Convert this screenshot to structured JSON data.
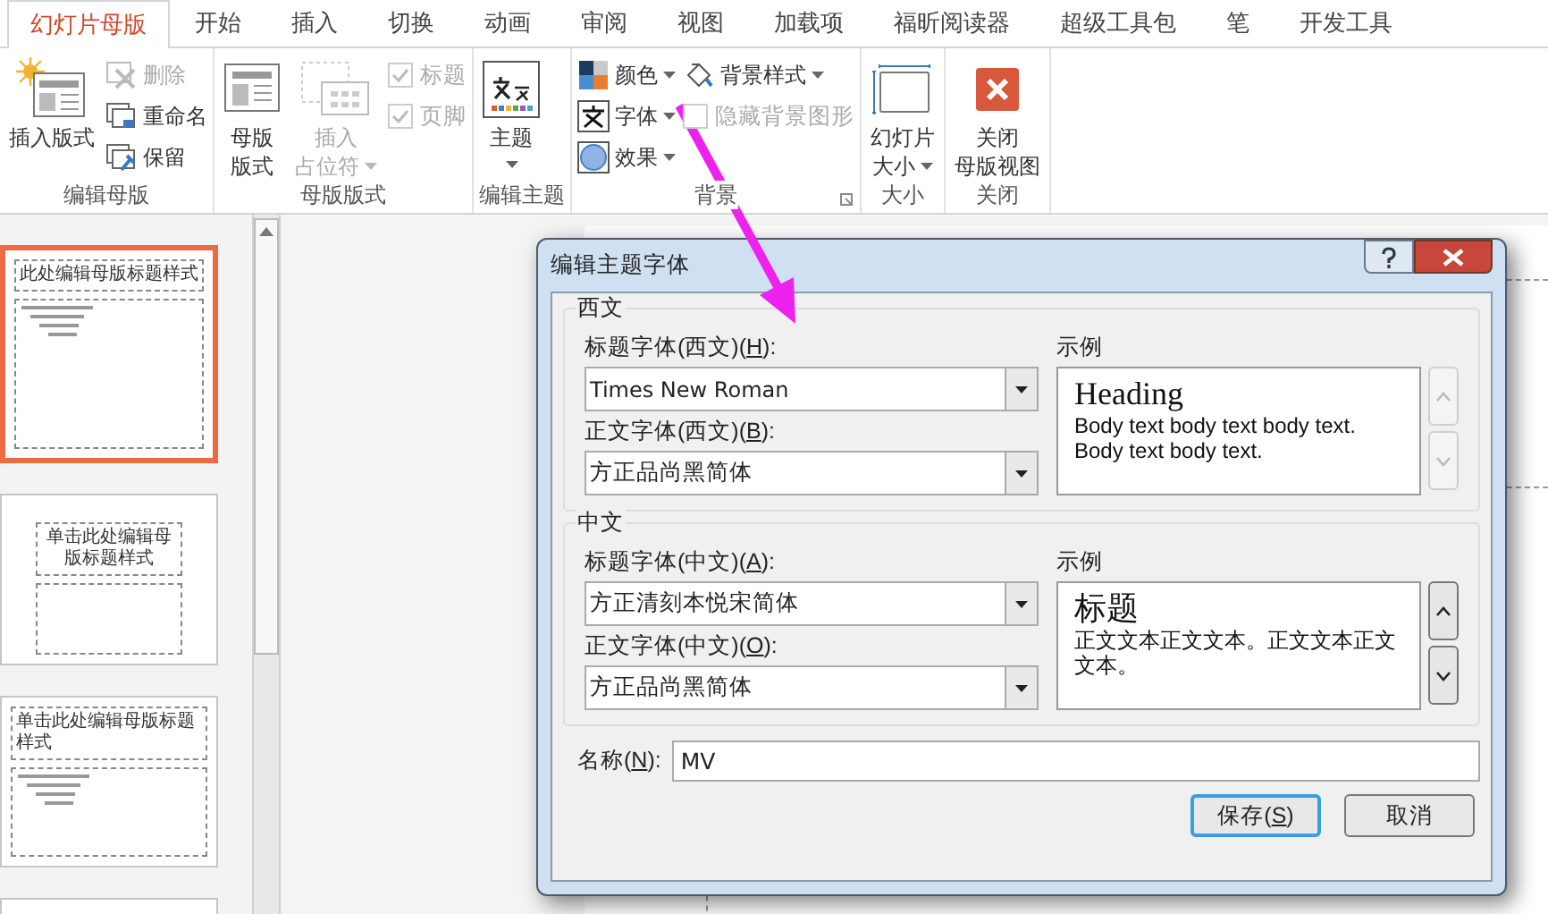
{
  "tabs": [
    {
      "label": "幻灯片母版",
      "selected": true
    },
    {
      "label": "开始",
      "selected": false
    },
    {
      "label": "插入",
      "selected": false
    },
    {
      "label": "切换",
      "selected": false
    },
    {
      "label": "动画",
      "selected": false
    },
    {
      "label": "审阅",
      "selected": false
    },
    {
      "label": "视图",
      "selected": false
    },
    {
      "label": "加载项",
      "selected": false
    },
    {
      "label": "福昕阅读器",
      "selected": false
    },
    {
      "label": "超级工具包",
      "selected": false
    },
    {
      "label": "笔",
      "selected": false
    },
    {
      "label": "开发工具",
      "selected": false
    }
  ],
  "ribbon_groups": [
    {
      "label": "编辑母版",
      "items": [
        {
          "kind": "large",
          "lines": [
            "插入版式"
          ],
          "disabled": false,
          "dropdown": false
        },
        {
          "kind": "column",
          "items": [
            {
              "kind": "small",
              "label": "删除",
              "disabled": true,
              "dropdown": false
            },
            {
              "kind": "small",
              "label": "重命名",
              "disabled": false,
              "dropdown": false
            },
            {
              "kind": "small",
              "label": "保留",
              "disabled": false,
              "dropdown": false
            }
          ]
        }
      ]
    },
    {
      "label": "母版版式",
      "items": [
        {
          "kind": "large",
          "lines": [
            "母版",
            "版式"
          ],
          "disabled": false,
          "dropdown": false
        },
        {
          "kind": "large",
          "lines": [
            "插入",
            "占位符"
          ],
          "disabled": true,
          "dropdown": true
        },
        {
          "kind": "column",
          "items": [
            {
              "kind": "checkbox",
              "label": "标题",
              "checked": true,
              "disabled": true
            },
            {
              "kind": "checkbox",
              "label": "页脚",
              "checked": true,
              "disabled": true
            }
          ]
        }
      ]
    },
    {
      "label": "编辑主题",
      "items": [
        {
          "kind": "large",
          "lines": [
            "主题"
          ],
          "disabled": false,
          "dropdown": true
        }
      ]
    },
    {
      "label": "背景",
      "launcher": true,
      "items": [
        {
          "kind": "column",
          "items": [
            {
              "kind": "small",
              "label": "颜色",
              "disabled": false,
              "dropdown": true
            },
            {
              "kind": "small",
              "label": "字体",
              "disabled": false,
              "dropdown": true
            },
            {
              "kind": "small",
              "label": "效果",
              "disabled": false,
              "dropdown": true
            }
          ]
        },
        {
          "kind": "column",
          "items": [
            {
              "kind": "small",
              "label": "背景样式",
              "disabled": false,
              "dropdown": true
            },
            {
              "kind": "checkbox",
              "label": "隐藏背景图形",
              "checked": false,
              "disabled": true
            }
          ]
        }
      ]
    },
    {
      "label": "大小",
      "items": [
        {
          "kind": "large",
          "lines": [
            "幻灯片",
            "大小"
          ],
          "disabled": false,
          "dropdown": true
        }
      ]
    },
    {
      "label": "关闭",
      "items": [
        {
          "kind": "large",
          "lines": [
            "关闭",
            "母版视图"
          ],
          "disabled": false,
          "dropdown": false
        }
      ]
    }
  ],
  "thumbnails": [
    {
      "title": "此处编辑母版标题样式",
      "kind": "master",
      "selected": true
    },
    {
      "title": "单击此处编辑母版标题样式",
      "kind": "title",
      "selected": false
    },
    {
      "title": "单击此处编辑母版标题样式",
      "kind": "content",
      "selected": false
    },
    {
      "kind": "blank",
      "selected": false
    }
  ],
  "dialog": {
    "title": "编辑主题字体",
    "sections": [
      {
        "heading": "西文",
        "fields": [
          {
            "label": "标题字体(西文)(H):",
            "value": "Times New Roman"
          },
          {
            "label": "正文字体(西文)(B):",
            "value": "方正品尚黑简体"
          }
        ],
        "sample_label": "示例",
        "sample_heading": "Heading",
        "sample_body": "Body text body text body text. Body text body text.",
        "scroll_enabled": false
      },
      {
        "heading": "中文",
        "fields": [
          {
            "label": "标题字体(中文)(A):",
            "value": "方正清刻本悦宋简体"
          },
          {
            "label": "正文字体(中文)(O):",
            "value": "方正品尚黑简体"
          }
        ],
        "sample_label": "示例",
        "sample_heading": "标题",
        "sample_body": "正文文本正文文本。正文文本正文文本。",
        "scroll_enabled": true
      }
    ],
    "name_label": "名称(N):",
    "name_value": "MV",
    "buttons": [
      {
        "label": "保存(S)",
        "default": true
      },
      {
        "label": "取消",
        "default": false
      }
    ]
  }
}
